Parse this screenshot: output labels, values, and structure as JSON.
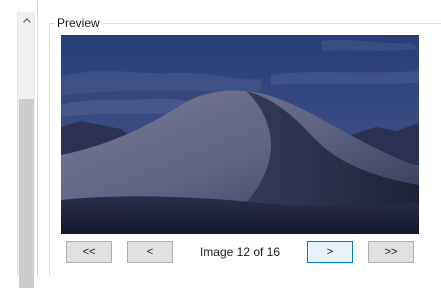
{
  "preview": {
    "group_title": "Preview",
    "image_alt": "Desert dunes at dusk under a cloudy sky"
  },
  "navigation": {
    "first_label": "<<",
    "prev_label": "<",
    "counter_text": "Image 12 of 16",
    "next_label": ">",
    "last_label": ">>",
    "focused": "next"
  },
  "scrollbar": {
    "up_arrow": "^"
  },
  "icons": {
    "scroll_up": "chevron-up-icon"
  }
}
